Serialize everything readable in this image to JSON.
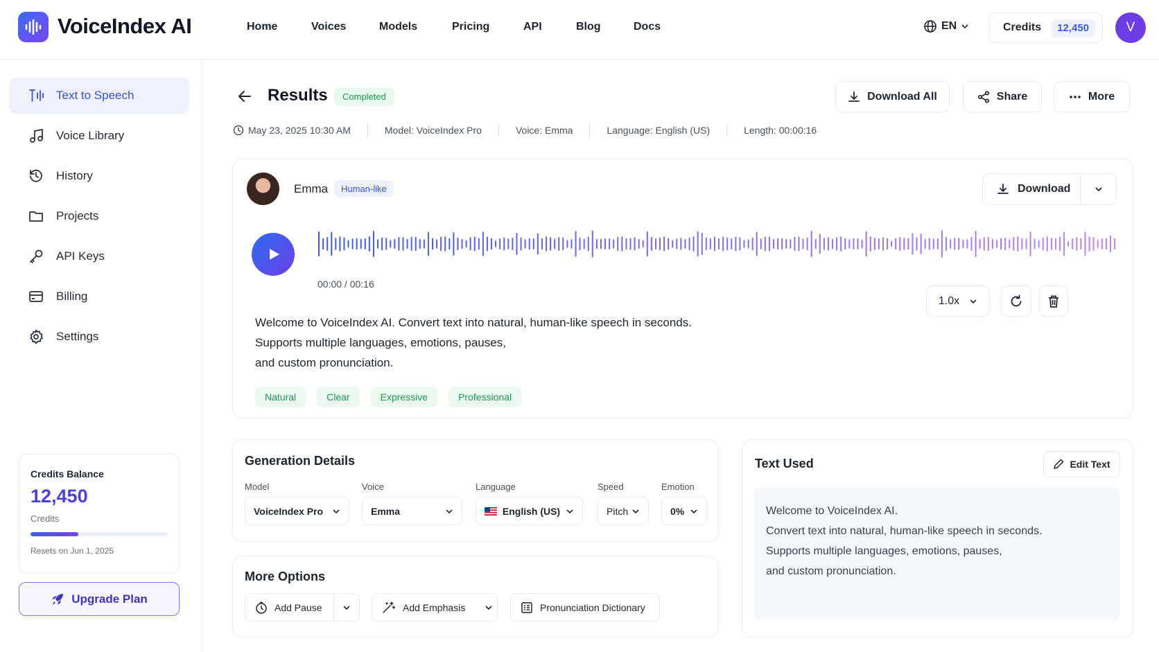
{
  "brand": {
    "name": "VoiceIndex AI"
  },
  "nav": {
    "items": [
      "Home",
      "Voices",
      "Models",
      "Pricing",
      "API",
      "Blog",
      "Docs"
    ]
  },
  "header": {
    "language": "EN",
    "credits_label": "Credits",
    "credits_value": "12,450",
    "avatar_initial": "V"
  },
  "sidebar": {
    "items": [
      {
        "label": "Text to Speech",
        "icon": "text-to-speech-icon",
        "active": true
      },
      {
        "label": "Voice Library",
        "icon": "music-note-icon"
      },
      {
        "label": "History",
        "icon": "history-icon"
      },
      {
        "label": "Projects",
        "icon": "folder-icon"
      },
      {
        "label": "API Keys",
        "icon": "key-icon"
      },
      {
        "label": "Billing",
        "icon": "credit-card-icon"
      },
      {
        "label": "Settings",
        "icon": "gear-icon"
      }
    ],
    "balance": {
      "title": "Credits Balance",
      "value": "12,450",
      "unit": "Credits",
      "progress": 0.35,
      "reset": "Resets on Jun 1, 2025"
    },
    "upgrade": "Upgrade Plan"
  },
  "results": {
    "title": "Results",
    "status": "Completed",
    "actions": {
      "download_all": "Download All",
      "share": "Share",
      "more": "More"
    },
    "meta": {
      "date": "May 23, 2025 10:30 AM",
      "model": "Model: VoiceIndex Pro",
      "voice": "Voice: Emma",
      "language": "Language: English (US)",
      "length": "Length: 00:00:16"
    }
  },
  "player": {
    "voice_name": "Emma",
    "voice_tag": "Human-like",
    "download": "Download",
    "time": "00:00 / 00:16",
    "speed": "1.0x",
    "text_lines": [
      "Welcome to VoiceIndex AI. Convert text into natural, human-like speech in seconds.",
      "Supports multiple languages, emotions, pauses,",
      "and custom pronunciation."
    ],
    "tags": [
      "Natural",
      "Clear",
      "Expressive",
      "Professional"
    ]
  },
  "generation": {
    "title": "Generation Details",
    "labels": {
      "model": "Model",
      "voice": "Voice",
      "language": "Language",
      "speed": "Speed",
      "emotion": "Emotion"
    },
    "values": {
      "model": "VoiceIndex Pro",
      "voice": "Emma",
      "language": "English (US)",
      "speed": "Pitch",
      "emotion": "0%"
    }
  },
  "more_options": {
    "title": "More Options",
    "add_pause": "Add Pause",
    "add_emphasis": "Add Emphasis",
    "pronunciation": "Pronunciation Dictionary"
  },
  "text_used": {
    "title": "Text Used",
    "edit": "Edit Text",
    "lines": [
      "Welcome to VoiceIndex AI.",
      "Convert text into natural, human-like speech in seconds.",
      "Supports multiple languages, emotions, pauses,",
      "and custom pronunciation."
    ]
  },
  "colors": {
    "accent": "#3b5bf0",
    "accent2": "#7a45f0",
    "success": "#1d9a52"
  }
}
